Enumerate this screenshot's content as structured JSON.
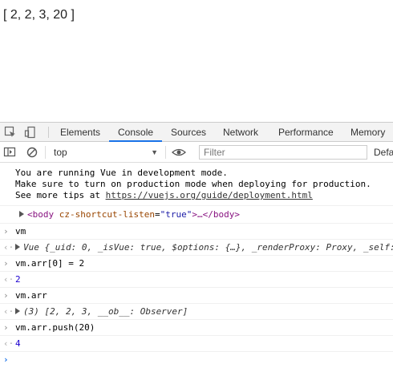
{
  "page": {
    "array_text": "[ 2, 2, 3, 20 ]"
  },
  "devtools": {
    "tabs": [
      "Elements",
      "Console",
      "Sources",
      "Network",
      "Performance",
      "Memory"
    ],
    "active_tab": "Console",
    "context": "top",
    "filter_placeholder": "Filter",
    "levels_label": "Defa"
  },
  "console": {
    "vue_msg_1": "You are running Vue in development mode.",
    "vue_msg_2": "Make sure to turn on production mode when deploying for production.",
    "vue_msg_3_prefix": "See more tips at ",
    "vue_msg_3_link": "https://vuejs.org/guide/deployment.html",
    "body_tag_open": "<body",
    "body_attr_name": "cz-shortcut-listen",
    "body_attr_eq": "=",
    "body_attr_value": "\"true\"",
    "body_tag_rest": ">…</body>",
    "entries": [
      {
        "input": "vm",
        "output": "Vue {_uid: 0, _isVue: true, $options: {…}, _renderProxy: Proxy, _self:"
      },
      {
        "input": "vm.arr[0] = 2",
        "output": "2"
      },
      {
        "input": "vm.arr",
        "output": "(3) [2, 2, 3, __ob__: Observer]"
      },
      {
        "input": "vm.arr.push(20)",
        "output": "4"
      }
    ]
  },
  "colors": {
    "accent": "#1a73e8",
    "number": "#1c00cf",
    "tag": "#881280"
  }
}
